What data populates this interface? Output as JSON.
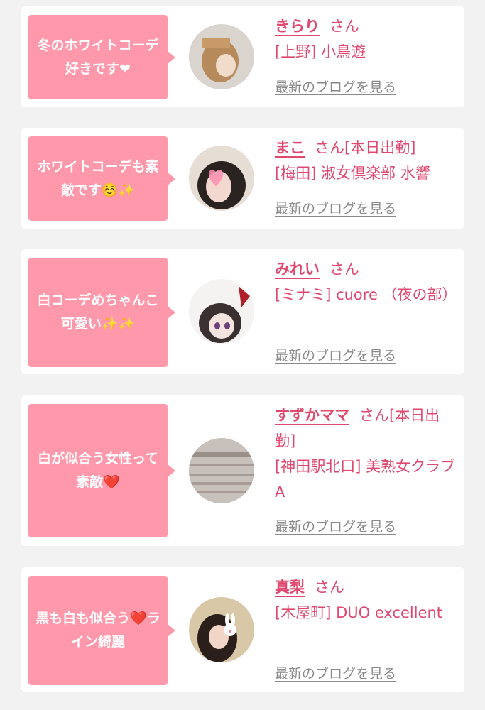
{
  "cards": [
    {
      "message": "冬のホワイトコーデ好きです❤",
      "name": "きらり",
      "honorific": "さん",
      "status": "",
      "area": "[上野]",
      "shop": "小鳥遊",
      "blog_link": "最新のブログを見る"
    },
    {
      "message": "ホワイトコーデも素敵です☺️✨",
      "name": "まこ",
      "honorific": "さん",
      "status": "[本日出勤]",
      "area": "[梅田]",
      "shop": "淑女倶楽部 水響",
      "blog_link": "最新のブログを見る"
    },
    {
      "message": "白コーデめちゃんこ可愛い✨✨",
      "name": "みれい",
      "honorific": "さん",
      "status": "",
      "area": "[ミナミ]",
      "shop": "cuore （夜の部）",
      "blog_link": "最新のブログを見る"
    },
    {
      "message": "白が似合う女性って素敵❤️",
      "name": "すずかママ",
      "honorific": "さん",
      "status": "[本日出勤]",
      "area": "[神田駅北口]",
      "shop": "美熟女クラブA",
      "blog_link": "最新のブログを見る"
    },
    {
      "message": "黒も白も似合う❤️ライン綺麗",
      "name": "真梨",
      "honorific": "さん",
      "status": "",
      "area": "[木屋町]",
      "shop": "DUO excellent",
      "blog_link": "最新のブログを見る"
    }
  ],
  "colors": {
    "accent": "#e0486f",
    "bubble": "#ff98ab",
    "link": "#8a8a8a",
    "background": "#f2f2f2"
  }
}
